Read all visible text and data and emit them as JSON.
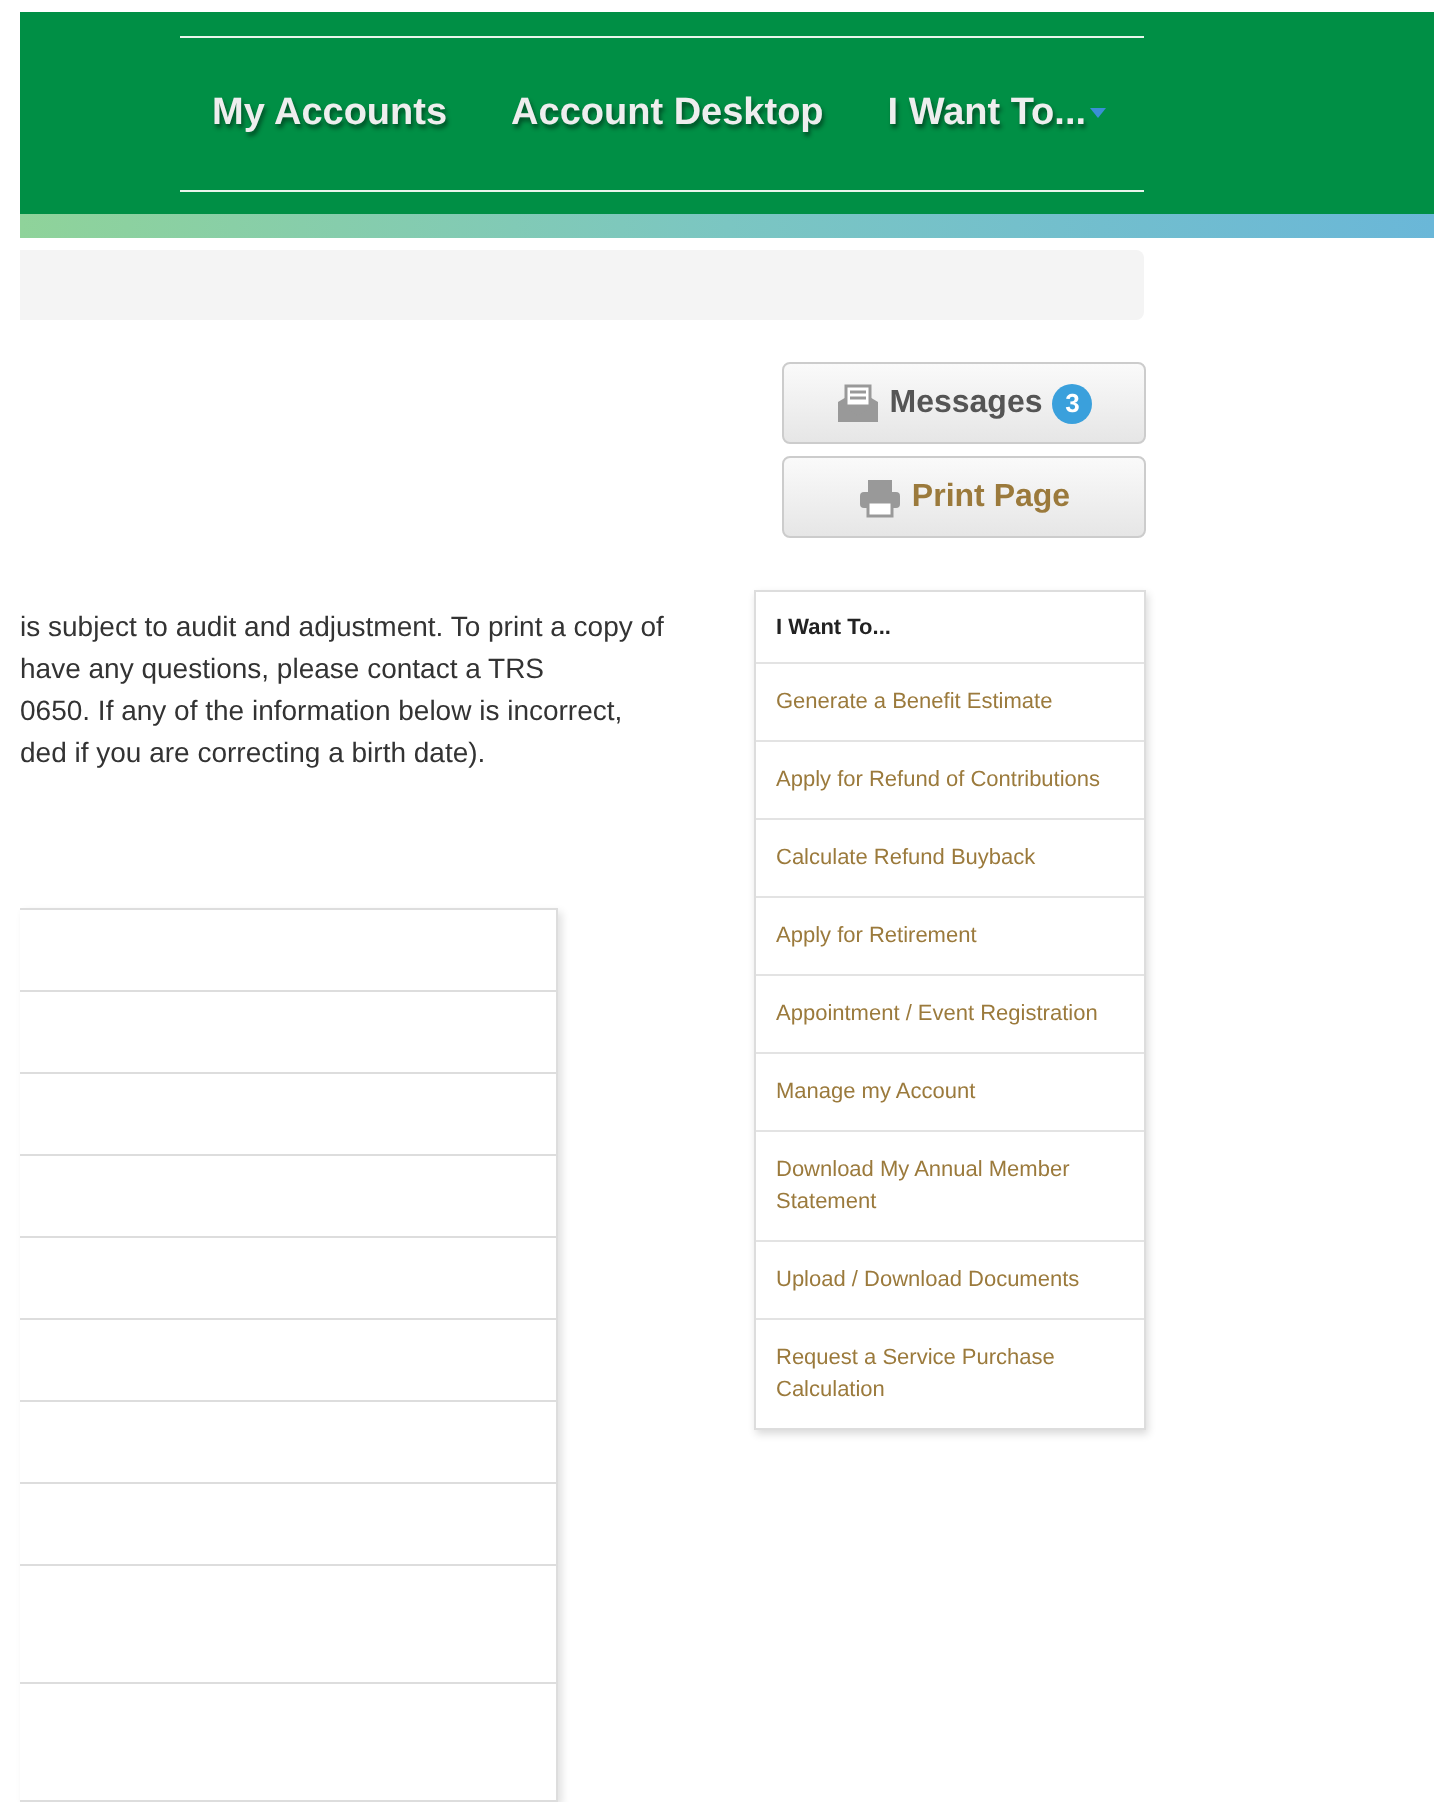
{
  "nav": {
    "items": [
      {
        "label": "My Accounts",
        "dropdown": false
      },
      {
        "label": "Account Desktop",
        "dropdown": false
      },
      {
        "label": "I Want To...",
        "dropdown": true
      }
    ]
  },
  "actions": {
    "messages": {
      "label": "Messages",
      "count": "3"
    },
    "print": {
      "label": "Print Page"
    }
  },
  "intro_lines": [
    "is subject to audit and adjustment. To print a copy of",
    "have any questions, please contact a TRS",
    "0650. If any of the information below is incorrect,",
    "ded if you are correcting a birth date)."
  ],
  "i_want_to": {
    "title": "I Want To...",
    "items": [
      "Generate a Benefit Estimate",
      "Apply for Refund of Contributions",
      "Calculate Refund Buyback",
      "Apply for Retirement",
      "Appointment / Event Registration",
      "Manage my Account",
      "Download My Annual Member Statement",
      "Upload / Download Documents",
      "Request a Service Purchase Calculation"
    ]
  }
}
